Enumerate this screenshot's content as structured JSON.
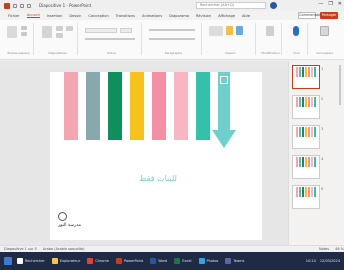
{
  "titlebar": {
    "title": "Diapositive 1 - PowerPoint",
    "search_placeholder": "Rechercher (Alt+Q)",
    "controls": [
      "—",
      "❐",
      "✕"
    ]
  },
  "tabs": [
    "Fichier",
    "Accueil",
    "Insertion",
    "Dessin",
    "Conception",
    "Transitions",
    "Animations",
    "Diaporama",
    "Révision",
    "Affichage",
    "Aide"
  ],
  "active_tab": "Accueil",
  "share_label": "Partager",
  "comments_label": "Commentaires",
  "ribbon": {
    "groups": [
      "Presse-papiers",
      "Diapositives",
      "Police",
      "Paragraphe",
      "Dessin",
      "Modification",
      "Voix",
      "Concepteur"
    ]
  },
  "slide": {
    "title_text": "للبنات فقط",
    "logo_text": "مدرسة النور",
    "bar_colors": [
      "#f4a6b0",
      "#87a8ad",
      "#0f8f5e",
      "#f6c21b",
      "#f58fa3",
      "#f7b6c2",
      "#33c2a9"
    ],
    "arrow_color": "#6ed0cc"
  },
  "thumbnails": {
    "numbers": [
      "1",
      "2",
      "3",
      "4",
      "5"
    ],
    "active_index": 0
  },
  "statusbar": {
    "slide_info": "Diapositive 1 sur 5",
    "language": "Arabe (Arabie saoudite)",
    "notes_label": "Notes",
    "zoom": "46 %"
  },
  "taskbar": {
    "apps": [
      {
        "label": "Rechercher",
        "color": "#ffffff"
      },
      {
        "label": "Explorateur",
        "color": "#f7c548"
      },
      {
        "label": "Chrome",
        "color": "#e44134"
      },
      {
        "label": "PowerPoint",
        "color": "#c43e1c"
      },
      {
        "label": "Word",
        "color": "#2b579a"
      },
      {
        "label": "Excel",
        "color": "#217346"
      },
      {
        "label": "Photos",
        "color": "#3aa0e6"
      },
      {
        "label": "Teams",
        "color": "#6264a7"
      }
    ],
    "time": "10:24",
    "date": "12/03/2024"
  }
}
